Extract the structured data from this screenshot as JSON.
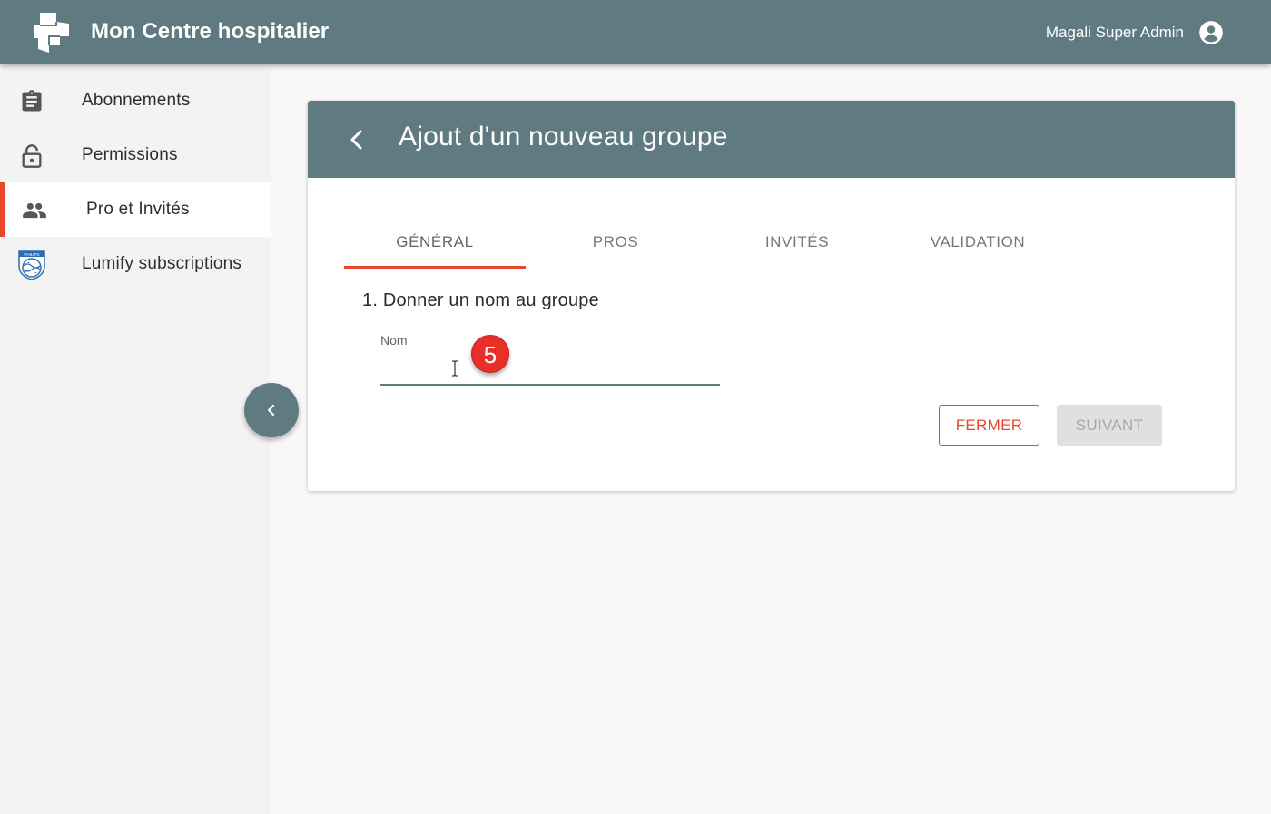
{
  "app": {
    "title": "Mon Centre hospitalier",
    "logo_icon": "hospital-logo-icon"
  },
  "user": {
    "name": "Magali Super Admin",
    "icon": "account-circle-icon"
  },
  "sidebar": {
    "items": [
      {
        "label": "Abonnements",
        "icon": "clipboard-icon",
        "active": false
      },
      {
        "label": "Permissions",
        "icon": "lock-icon",
        "active": false
      },
      {
        "label": "Pro et Invités",
        "icon": "people-icon",
        "active": true
      },
      {
        "label": "Lumify subscriptions",
        "icon": "philips-shield-icon",
        "active": false
      }
    ],
    "collapse_icon": "chevron-left-icon"
  },
  "card": {
    "title": "Ajout d'un nouveau groupe",
    "tabs": [
      {
        "label": "GÉNÉRAL",
        "active": true
      },
      {
        "label": "PROS",
        "active": false
      },
      {
        "label": "INVITÉS",
        "active": false
      },
      {
        "label": "VALIDATION",
        "active": false
      }
    ],
    "step_label": "1. Donner un nom au groupe",
    "name_field": {
      "label": "Nom",
      "value": ""
    },
    "step_badge": "5",
    "buttons": {
      "close": "FERMER",
      "next": "SUIVANT"
    }
  },
  "colors": {
    "primary": "#5f7b81",
    "accent": "#e8472b",
    "badge": "#e8302b",
    "disabled": "#e0e0e0"
  }
}
